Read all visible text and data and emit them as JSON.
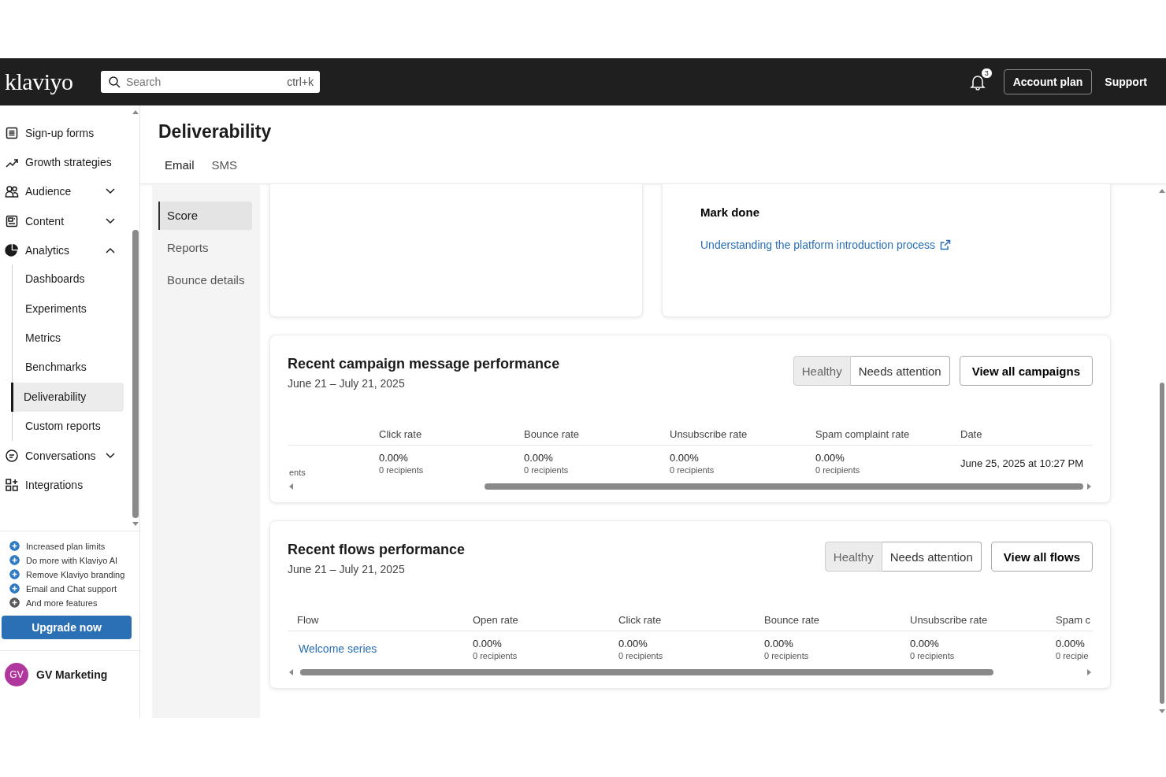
{
  "header": {
    "logo": "klaviyo",
    "search": {
      "placeholder": "Search",
      "shortcut": "ctrl+k"
    },
    "notifications": "3",
    "buttons": [
      {
        "label": "Account plan",
        "kind": "outline"
      },
      {
        "label": "Support",
        "kind": "plain"
      }
    ]
  },
  "sidebar": {
    "items": [
      {
        "label": "Sign-up forms",
        "kind": "link",
        "selected": false
      },
      {
        "label": "Growth strategies",
        "kind": "link",
        "selected": false
      },
      {
        "label": "Audience",
        "kind": "group",
        "expanded": false,
        "selected": false
      },
      {
        "label": "Content",
        "kind": "group",
        "expanded": false,
        "selected": false
      },
      {
        "label": "Analytics",
        "kind": "group",
        "expanded": true,
        "selected": false,
        "children": [
          {
            "label": "Dashboards",
            "selected": false
          },
          {
            "label": "Experiments",
            "selected": false
          },
          {
            "label": "Metrics",
            "selected": false
          },
          {
            "label": "Benchmarks",
            "selected": false
          },
          {
            "label": "Deliverability",
            "selected": true
          },
          {
            "label": "Custom reports",
            "selected": false
          }
        ]
      },
      {
        "label": "Conversations",
        "kind": "group",
        "expanded": false,
        "selected": false
      },
      {
        "label": "Integrations",
        "kind": "link",
        "selected": false
      }
    ],
    "promos": [
      {
        "text": "Increased plan limits",
        "color": "#2f7ac2"
      },
      {
        "text": "Do more with Klaviyo AI",
        "color": "#2f7ac2"
      },
      {
        "text": "Remove Klaviyo branding",
        "color": "#2f7ac2"
      },
      {
        "text": "Email and Chat support",
        "color": "#2f7ac2"
      },
      {
        "text": "And more features",
        "color": "#5a5a5a"
      }
    ],
    "upgrade_button": "Upgrade now",
    "account": {
      "initials": "GV",
      "name": "GV Marketing"
    }
  },
  "page": {
    "title": "Deliverability",
    "tabs": [
      {
        "label": "Email",
        "selected": true
      },
      {
        "label": "SMS",
        "selected": false
      }
    ],
    "subnav": [
      {
        "label": "Score",
        "selected": true
      },
      {
        "label": "Reports",
        "selected": false
      },
      {
        "label": "Bounce details",
        "selected": false
      }
    ]
  },
  "task_card": {
    "button": "Mark done",
    "link": "Understanding the platform introduction process"
  },
  "sections": [
    {
      "title": "Recent campaign message performance",
      "date_range": "June 21 – July 21, 2025",
      "filters": [
        {
          "label": "Healthy",
          "selected": true
        },
        {
          "label": "Needs attention",
          "selected": false
        }
      ],
      "view_button": "View all campaigns",
      "columns": [
        "",
        "Click rate",
        "Bounce rate",
        "Unsubscribe rate",
        "Spam complaint rate",
        "Date"
      ],
      "rows": [
        [
          {
            "kind": "cut",
            "text": "ents"
          },
          {
            "kind": "metric",
            "value": "0.00%",
            "detail": "0 recipients"
          },
          {
            "kind": "metric",
            "value": "0.00%",
            "detail": "0 recipients"
          },
          {
            "kind": "metric",
            "value": "0.00%",
            "detail": "0 recipients"
          },
          {
            "kind": "metric",
            "value": "0.00%",
            "detail": "0 recipients"
          },
          {
            "kind": "text",
            "text": "June 25, 2025 at 10:27 PM"
          }
        ]
      ]
    },
    {
      "title": "Recent flows performance",
      "date_range": "June 21 – July 21, 2025",
      "filters": [
        {
          "label": "Healthy",
          "selected": true
        },
        {
          "label": "Needs attention",
          "selected": false
        }
      ],
      "view_button": "View all flows",
      "columns": [
        "Flow",
        "Open rate",
        "Click rate",
        "Bounce rate",
        "Unsubscribe rate",
        "Spam c"
      ],
      "rows": [
        [
          {
            "kind": "link",
            "text": "Welcome series"
          },
          {
            "kind": "metric",
            "value": "0.00%",
            "detail": "0 recipients"
          },
          {
            "kind": "metric",
            "value": "0.00%",
            "detail": "0 recipients"
          },
          {
            "kind": "metric",
            "value": "0.00%",
            "detail": "0 recipients"
          },
          {
            "kind": "metric",
            "value": "0.00%",
            "detail": "0 recipients"
          },
          {
            "kind": "metric",
            "value": "0.00%",
            "detail": "0 recipie"
          }
        ]
      ]
    }
  ]
}
